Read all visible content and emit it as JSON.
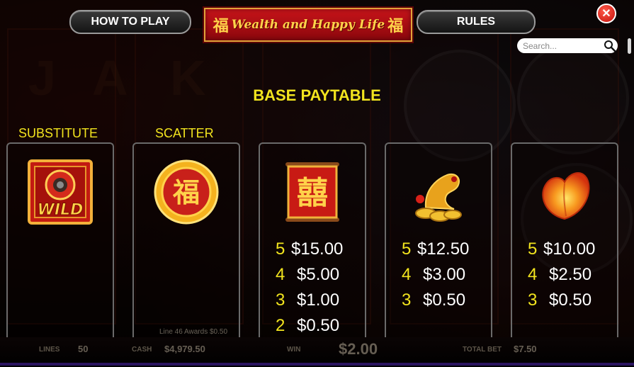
{
  "header": {
    "how_to_play_label": "HOW TO PLAY",
    "title": "Wealth and Happy Life",
    "title_glyph": "福",
    "rules_label": "RULES",
    "close_icon": "close-icon"
  },
  "search": {
    "placeholder": "Search..."
  },
  "paytable": {
    "heading": "BASE PAYTABLE",
    "columns": [
      {
        "label": "SUBSTITUTE",
        "symbol": "wild",
        "symbol_text": "WILD",
        "pays": []
      },
      {
        "label": "SCATTER",
        "symbol": "scatter-fu-coin",
        "symbol_text": "福",
        "pays": []
      },
      {
        "label": "",
        "symbol": "double-happiness-banner",
        "symbol_text": "囍",
        "pays": [
          {
            "n": "5",
            "v": "$15.00"
          },
          {
            "n": "4",
            "v": "$5.00"
          },
          {
            "n": "3",
            "v": "$1.00"
          },
          {
            "n": "2",
            "v": "$0.50"
          }
        ]
      },
      {
        "label": "",
        "symbol": "golden-dragon-coins",
        "symbol_text": "",
        "pays": [
          {
            "n": "5",
            "v": "$12.50"
          },
          {
            "n": "4",
            "v": "$3.00"
          },
          {
            "n": "3",
            "v": "$0.50"
          }
        ]
      },
      {
        "label": "",
        "symbol": "peach",
        "symbol_text": "",
        "pays": [
          {
            "n": "5",
            "v": "$10.00"
          },
          {
            "n": "4",
            "v": "$2.50"
          },
          {
            "n": "3",
            "v": "$0.50"
          }
        ]
      }
    ]
  },
  "status_bar": {
    "line_awards": "Line 46 Awards $0.50",
    "lines_label": "LINES",
    "lines_value": "50",
    "cash_label": "CASH",
    "cash_value": "$4,979.50",
    "win_label": "WIN",
    "win_value": "$2.00",
    "total_bet_label": "TOTAL BET",
    "total_bet_value": "$7.50"
  },
  "colors": {
    "accent_yellow": "#f2e41e",
    "banner_red": "#c8141a",
    "gold": "#ffd24a"
  }
}
